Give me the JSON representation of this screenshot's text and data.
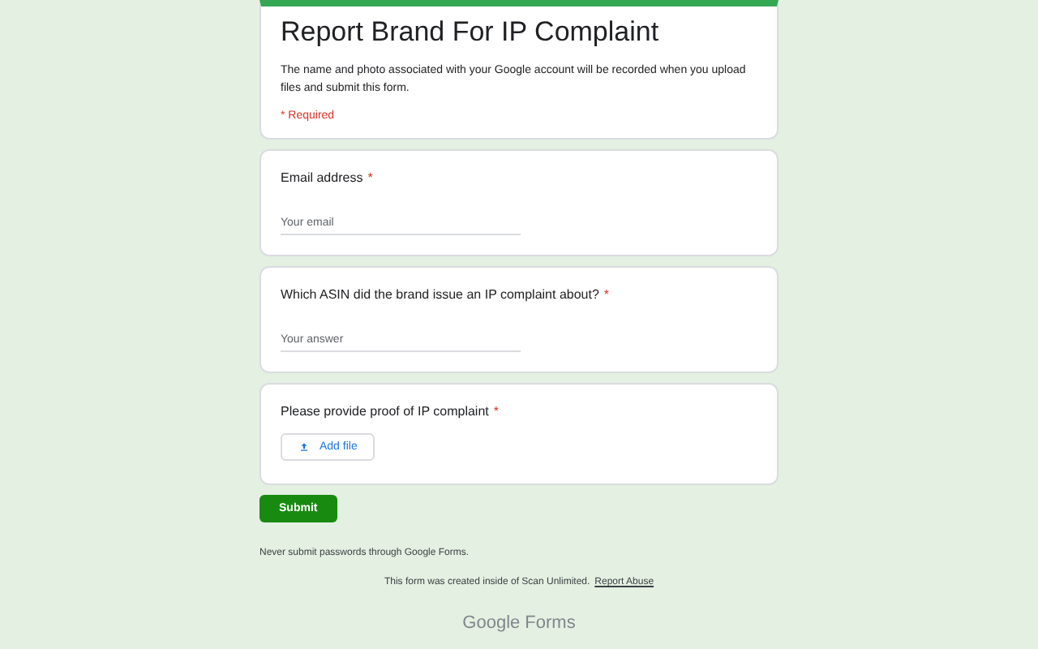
{
  "header": {
    "title": "Report Brand For IP Complaint",
    "description": "The name and photo associated with your Google account will be recorded when you upload files and submit this form.",
    "required_note": "* Required"
  },
  "questions": [
    {
      "kind": "text",
      "label": "Email address",
      "required_mark": "*",
      "placeholder": "Your email"
    },
    {
      "kind": "text",
      "label": "Which ASIN did the brand issue an IP complaint about?",
      "required_mark": "*",
      "placeholder": "Your answer"
    },
    {
      "kind": "file",
      "label": "Please provide proof of IP complaint",
      "required_mark": "*",
      "button": "Add file"
    }
  ],
  "submit": "Submit",
  "warning": "Never submit passwords through Google Forms.",
  "footer": {
    "text": "This form was created inside of Scan Unlimited.",
    "link": "Report Abuse"
  },
  "brand": {
    "word1": "Google",
    "word2": "Forms"
  }
}
